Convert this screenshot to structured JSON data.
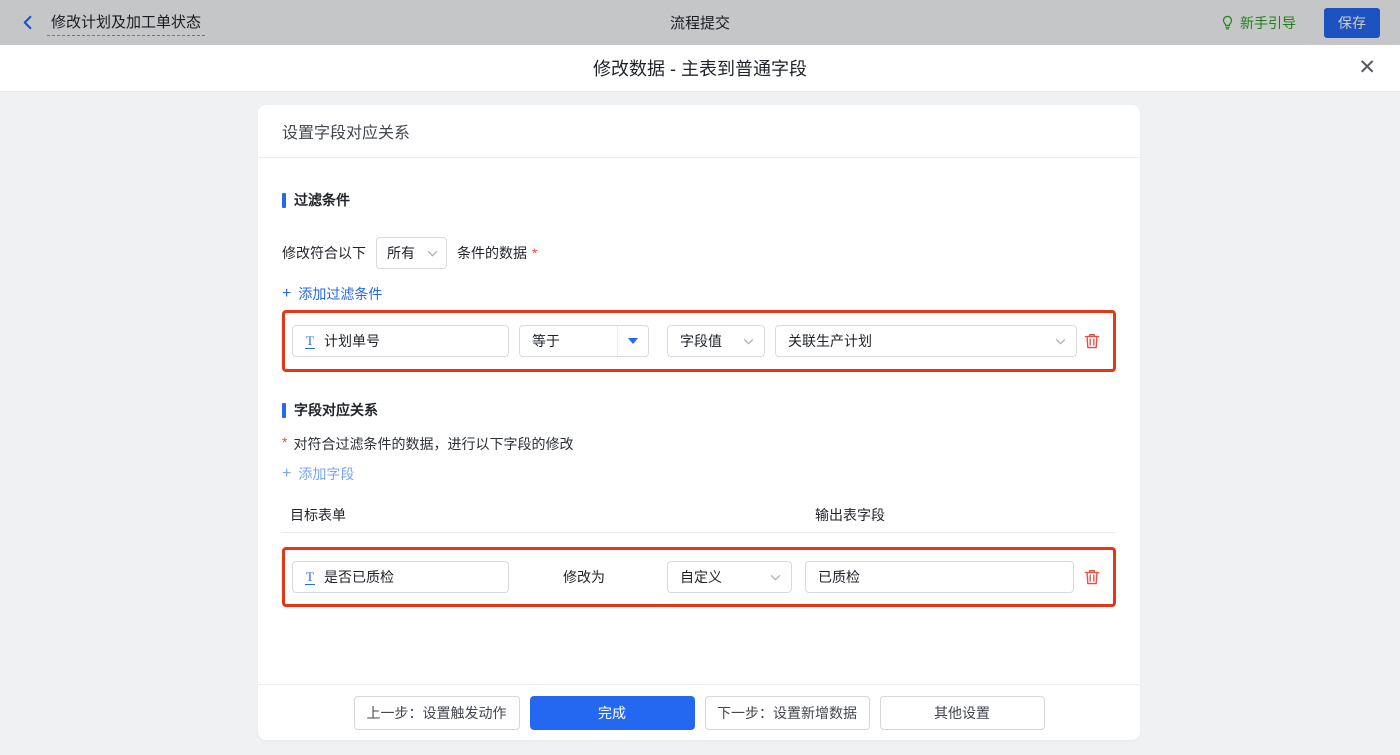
{
  "topbar": {
    "back_icon": "chevron-left-icon",
    "title": "修改计划及加工单状态",
    "center_title": "流程提交",
    "guide_icon": "lightbulb-icon",
    "guide_label": "新手引导",
    "save_label": "保存"
  },
  "dialog": {
    "title": "修改数据 - 主表到普通字段",
    "close_glyph": "✕"
  },
  "card": {
    "header": "设置字段对应关系",
    "filter_section": {
      "title": "过滤条件",
      "sentence_prefix": "修改符合以下",
      "match_value": "所有",
      "sentence_suffix": "条件的数据",
      "required_mark": "*",
      "add_plus": "+",
      "add_link": "添加过滤条件",
      "row": {
        "field_icon": "T",
        "field_name": "计划单号",
        "operator": "等于",
        "value_type": "字段值",
        "value": "关联生产计划"
      }
    },
    "mapping_section": {
      "title": "字段对应关系",
      "required_mark": "*",
      "hint": "对符合过滤条件的数据，进行以下字段的修改",
      "add_plus": "+",
      "add_link": "添加字段",
      "columns": {
        "left": "目标表单",
        "right": "输出表字段"
      },
      "row": {
        "field_icon": "T",
        "field_name": "是否已质检",
        "middle_label": "修改为",
        "value_type": "自定义",
        "value": "已质检"
      }
    },
    "footer": {
      "prev_label": "上一步：设置触发动作",
      "done_label": "完成",
      "next_label": "下一步：设置新增数据",
      "other_label": "其他设置"
    }
  },
  "colors": {
    "accent_blue": "#2468f2",
    "highlight_red": "#e53717",
    "danger_red": "#f2493f",
    "guide_green": "#2aa121"
  }
}
